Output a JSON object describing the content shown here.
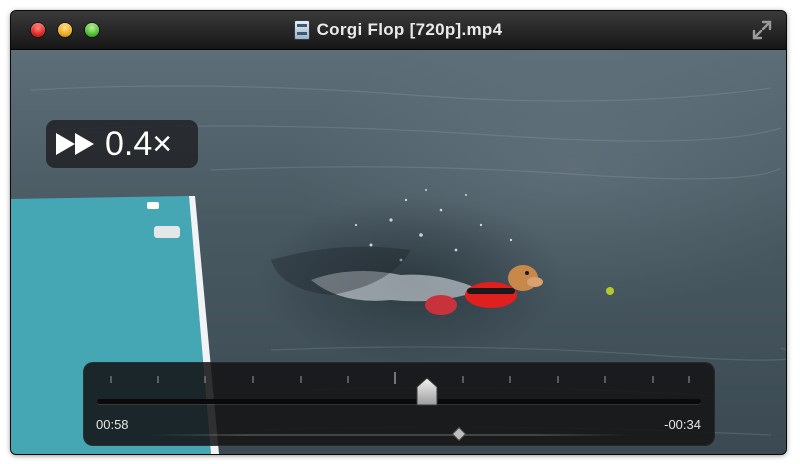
{
  "window": {
    "title": "Corgi Flop [720p].mp4",
    "controls": [
      "close",
      "minimize",
      "zoom"
    ],
    "fullscreen_icon": "fullscreen-arrows-icon",
    "file_icon": "video-file-icon"
  },
  "video": {
    "scene": "corgi-swimming-in-lake"
  },
  "overlay": {
    "speed_icon": "fast-forward-icon",
    "speed_label": "0.4×"
  },
  "scrubber": {
    "elapsed": "00:58",
    "remaining": "-00:34",
    "position_fraction": 0.63
  },
  "colors": {
    "close": "#e0231f",
    "minimize": "#e9a81c",
    "zoom": "#4cbc2c",
    "dock": "#45a6b4"
  }
}
